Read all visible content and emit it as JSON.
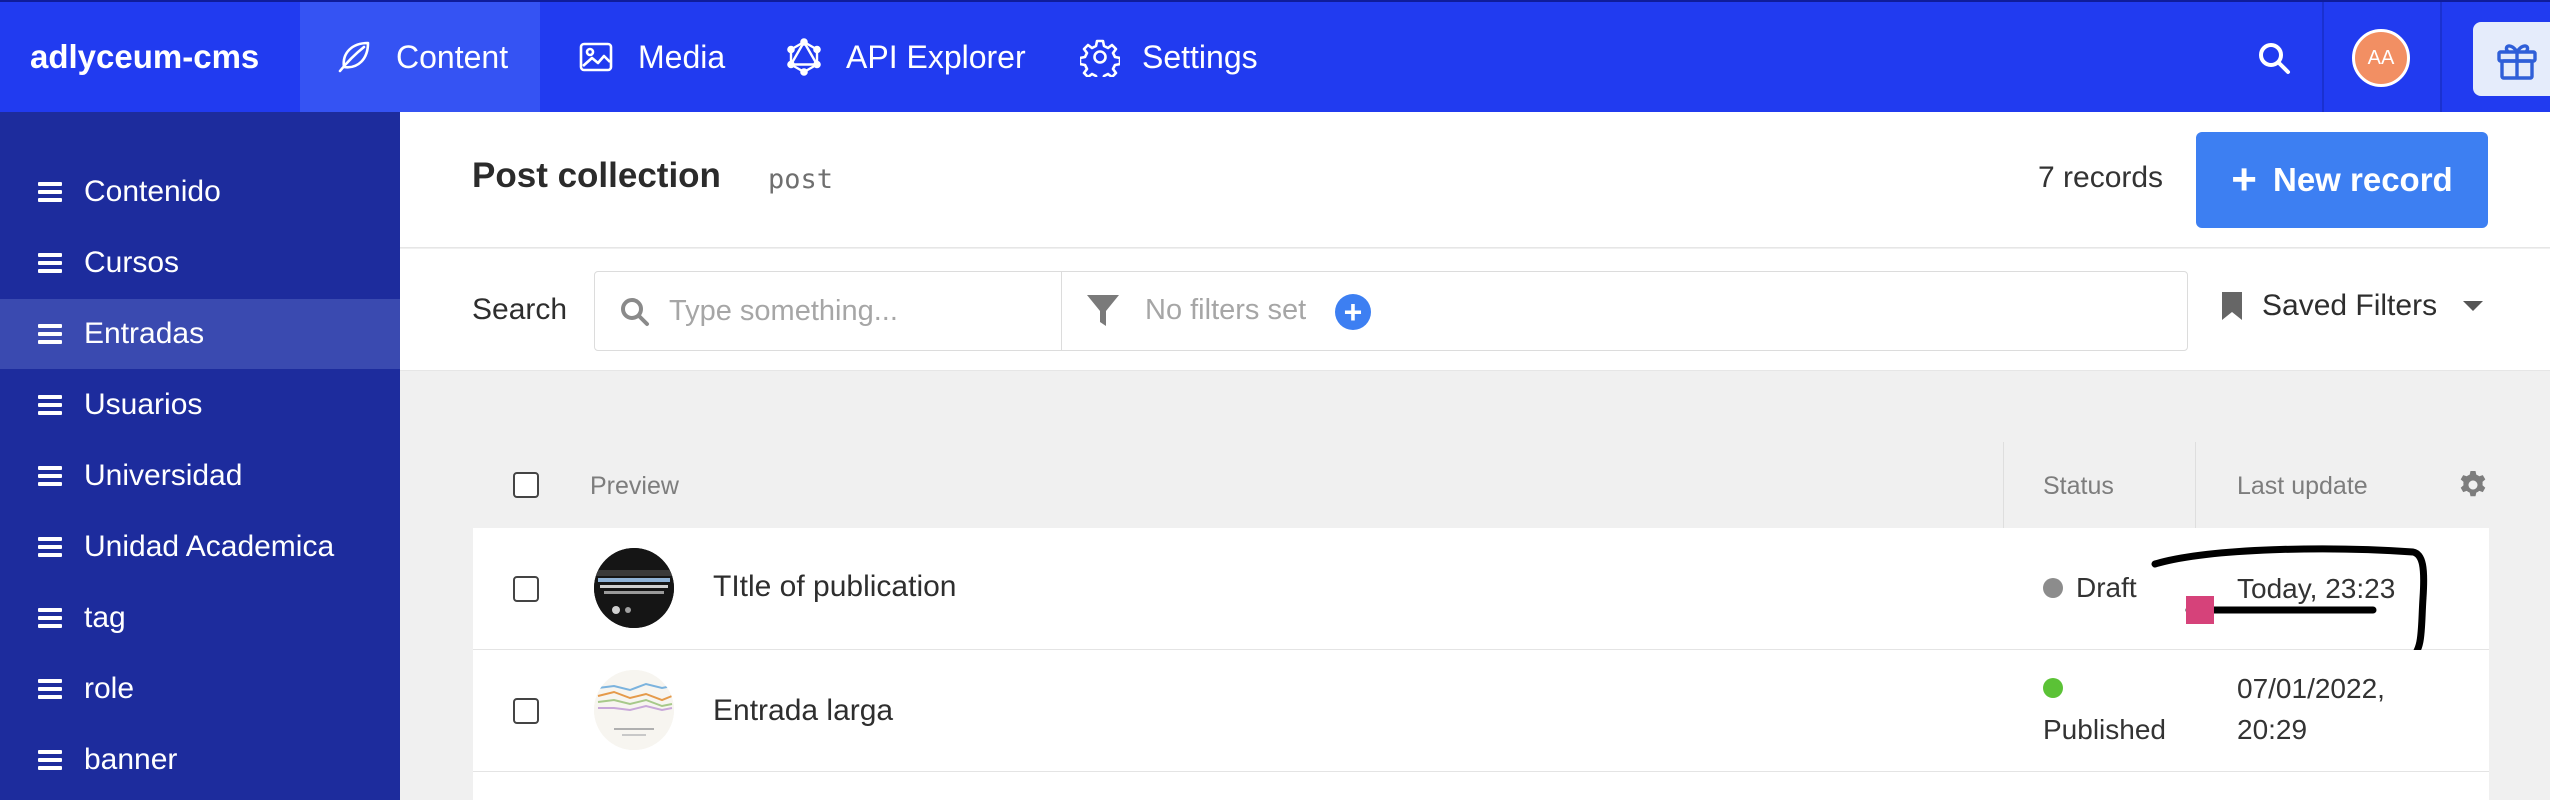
{
  "brand": "adlyceum-cms",
  "nav": {
    "content": "Content",
    "media": "Media",
    "api_explorer": "API Explorer",
    "settings": "Settings"
  },
  "user": {
    "initials": "AA",
    "avatar_color": "#f28f63"
  },
  "colors": {
    "topbar": "#213bf0",
    "sidebar": "#1d2c9d",
    "accent": "#3d7ff2",
    "published": "#5bc236",
    "draft": "#8c8c8c",
    "annotation": "#d6427a"
  },
  "sidebar": {
    "items": [
      {
        "label": "Contenido"
      },
      {
        "label": "Cursos"
      },
      {
        "label": "Entradas"
      },
      {
        "label": "Usuarios"
      },
      {
        "label": "Universidad"
      },
      {
        "label": "Unidad Academica"
      },
      {
        "label": "tag"
      },
      {
        "label": "role"
      },
      {
        "label": "banner"
      }
    ],
    "active": "Entradas"
  },
  "header": {
    "title": "Post collection",
    "api_key": "post",
    "records": "7 records",
    "new_button": "New record"
  },
  "search": {
    "label": "Search",
    "placeholder": "Type something...",
    "filters_text": "No filters set",
    "saved_filters": "Saved Filters"
  },
  "table": {
    "columns": {
      "preview": "Preview",
      "status": "Status",
      "last_update": "Last update"
    },
    "rows": [
      {
        "title": "TItle of publication",
        "status": "Draft",
        "last_update": "Today, 23:23"
      },
      {
        "title": "Entrada larga",
        "status": "Published",
        "last_update_line1": "07/01/2022,",
        "last_update_line2": "20:29"
      }
    ]
  },
  "icons": [
    "leaf-icon",
    "image-icon",
    "graphql-icon",
    "gear-icon",
    "search-icon",
    "gift-icon",
    "menu-icon",
    "filter-icon",
    "plus-icon",
    "bookmark-icon",
    "chevron-down-icon"
  ]
}
